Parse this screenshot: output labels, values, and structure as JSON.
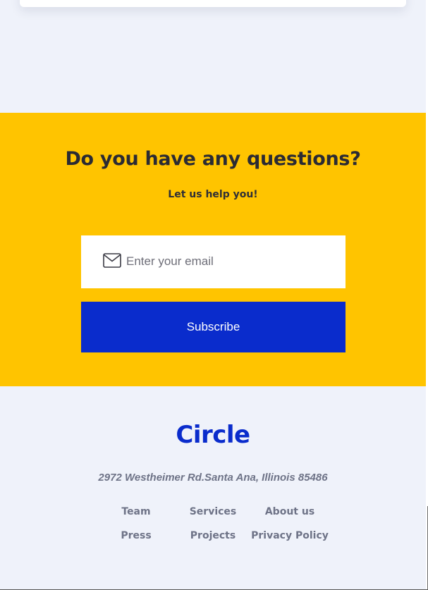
{
  "cta": {
    "title": "Do you have any questions?",
    "subtitle": "Let us help you!",
    "email_placeholder": "Enter your email",
    "subscribe_label": "Subscribe",
    "background_color": "#ffc400",
    "button_color": "#0a2ccc"
  },
  "footer": {
    "logo_text": "Circle",
    "address": "2972 Westheimer Rd.Santa Ana, Illinois 85486",
    "links": [
      "Team",
      "Services",
      "About us",
      "Press",
      "Projects",
      "Privacy Policy"
    ]
  },
  "icons": {
    "email": "mail-icon"
  }
}
